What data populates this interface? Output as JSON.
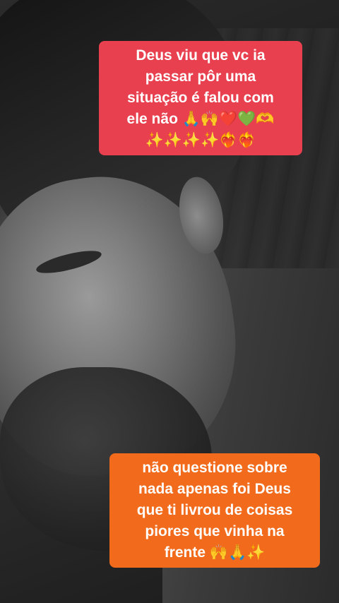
{
  "top_caption": {
    "background": "#e8404f",
    "lines": [
      "Deus viu que vc ia",
      "passar pôr uma",
      "situação é falou com",
      "ele não 🙏🙌❤️💚🫶",
      "✨✨✨✨❤️‍🔥❤️‍🔥"
    ]
  },
  "bottom_caption": {
    "background": "#f26a1b",
    "lines": [
      "não questione sobre",
      "nada apenas foi Deus",
      "que ti livrou de coisas",
      "piores que vinha na",
      "frente 🙌🙏✨"
    ]
  }
}
